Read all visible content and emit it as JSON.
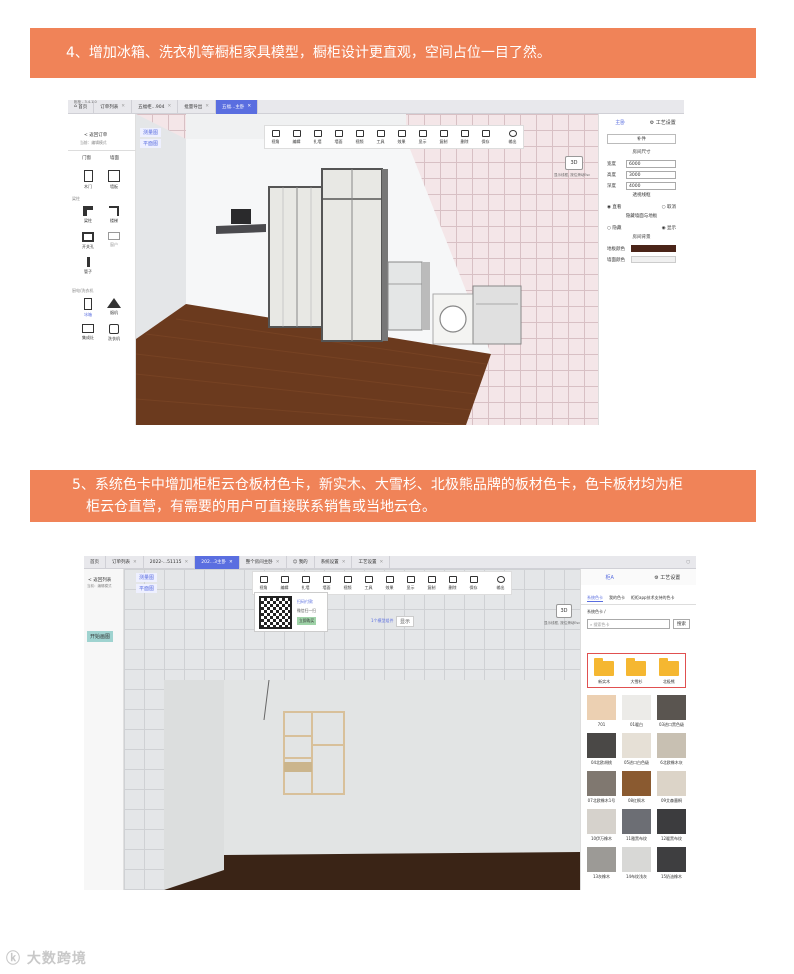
{
  "banner1": "4、增加冰箱、洗衣机等橱柜家具模型，橱柜设计更直观，空间占位一目了然。",
  "banner2_line1": "5、系统色卡中增加柜柜云仓板材色卡，新实木、大雪杉、北极熊品牌的板材色卡，色卡板材均为柜",
  "banner2_line2": "柜云仓直营，有需要的用户可直接联系销售或当地云仓。",
  "watermark": "大数跨境",
  "shot1": {
    "app_title": "柜柜 - 3.4.1.0",
    "tabs": [
      {
        "label": "首页"
      },
      {
        "label": "订单列表"
      },
      {
        "label": "五福柜...904"
      },
      {
        "label": "批量导出"
      },
      {
        "label": "五福...主卧"
      }
    ],
    "left": {
      "back": "< 返回订单",
      "mode": "当前：编辑模式",
      "view1": "测量图",
      "view2": "平面图",
      "cat_a": "门窗",
      "cat_b": "墙面",
      "items": [
        "木门",
        "墙板",
        "梁柱",
        "楼梯",
        "开关孔",
        "窗户",
        "管子",
        "冰箱",
        "烟机",
        "集成灶",
        "洗衣机"
      ],
      "section1": "梁柱",
      "section2": "厨电/洗衣机"
    },
    "toolbar": [
      "视角",
      "编辑",
      "扎墙",
      "墙面",
      "视频",
      "工具",
      "效果",
      "显示",
      "复制",
      "删除",
      "保存",
      "输出"
    ],
    "badge_3d": "3D",
    "badge_hint": "显示线框, 按住滑动Esc",
    "right": {
      "tab1": "主卧",
      "tab2": "工艺设置",
      "subtab": "补件",
      "room_size": "房间尺寸",
      "width_label": "宽度",
      "width": "6000",
      "height_label": "高度",
      "height": "3000",
      "depth_label": "深度",
      "depth": "4000",
      "ortho": "透视线框",
      "opt_a": "直看",
      "opt_b": "取消",
      "hidden_title": "隐藏墙面与地板",
      "opt_c": "隐藏",
      "opt_d": "显示",
      "bg_title": "房间背景",
      "floor_color": "地板颜色",
      "wall_color": "墙面颜色"
    }
  },
  "shot2": {
    "tabs": [
      {
        "label": "首页"
      },
      {
        "label": "订单列表"
      },
      {
        "label": "2022-...51115"
      },
      {
        "label": "202...3主卧"
      },
      {
        "label": "整个房间主卧"
      },
      {
        "label": "我的"
      },
      {
        "label": "系统设置"
      },
      {
        "label": "工艺设置"
      }
    ],
    "back": "< 返回列表",
    "mode": "当前：编辑模式",
    "view1": "测量图",
    "view2": "平面图",
    "start_btn": "开始画图",
    "toolbar": [
      "视角",
      "编辑",
      "扎墙",
      "墙面",
      "视频",
      "工具",
      "效果",
      "显示",
      "复制",
      "删除",
      "保存",
      "输出"
    ],
    "qr_title": "扫码付款",
    "qr_sub": "微信扫一扫",
    "qr_btn": "立即购买",
    "float_label": "1个模型组件",
    "float_btn": "显示",
    "badge_3d": "3D",
    "badge_hint": "显示线框, 按住滑动Esc",
    "right": {
      "tab1": "柜A",
      "tab2": "工艺设置",
      "subtabs": [
        "系统色卡",
        "我的色卡",
        "柜柜app技术支持的色卡"
      ],
      "path": "系统色卡 /",
      "search_placeholder": "搜索色卡",
      "search_btn": "搜索",
      "folders": [
        "新实木",
        "大雪杉",
        "北极熊"
      ],
      "swatches": [
        {
          "label": "701",
          "color": "#ecd0b2"
        },
        {
          "label": "01暖白",
          "color": "#ecebe8"
        },
        {
          "label": "03进口黑色级",
          "color": "#5a5550"
        },
        {
          "label": "04北欧胡桃",
          "color": "#4a4846"
        },
        {
          "label": "05进口白色级",
          "color": "#e6e0d6"
        },
        {
          "label": "6北欧橡木灰",
          "color": "#c8c0b2"
        },
        {
          "label": "07北欧橡木1号",
          "color": "#807870"
        },
        {
          "label": "08红枫木",
          "color": "#8a5a30"
        },
        {
          "label": "09艾森墨桐",
          "color": "#dcd4c8"
        },
        {
          "label": "10伊万橡木",
          "color": "#d6d2cc"
        },
        {
          "label": "11雅黑布纹",
          "color": "#6c6e74"
        },
        {
          "label": "12暖黑布纹",
          "color": "#3c3c3e"
        },
        {
          "label": "13灰橡木",
          "color": "#9c9a96"
        },
        {
          "label": "14布纹浅灰",
          "color": "#d8d8d6"
        },
        {
          "label": "15奶油橡木",
          "color": "#3e3e40"
        }
      ]
    }
  }
}
